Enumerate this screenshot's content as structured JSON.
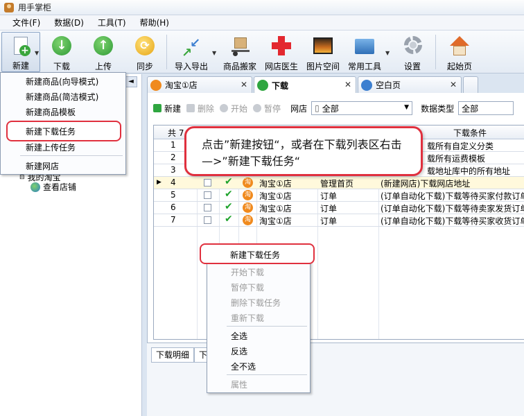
{
  "app": {
    "title": "用手掌柜"
  },
  "menu": [
    "文件(F)",
    "数据(D)",
    "工具(T)",
    "帮助(H)"
  ],
  "toolbar": {
    "new": "新建",
    "download": "下载",
    "upload": "上传",
    "sync": "同步",
    "import_export": "导入导出",
    "move_goods": "商品搬家",
    "shop_doctor": "网店医生",
    "image_space": "图片空间",
    "common_tools": "常用工具",
    "settings": "设置",
    "home": "起始页"
  },
  "new_menu": {
    "items": [
      "新建商品(向导模式)",
      "新建商品(简洁模式)",
      "新建商品模板",
      "新建下载任务",
      "新建上传任务",
      "新建网店"
    ]
  },
  "tree": {
    "my_taobao": "我的淘宝",
    "view_shop": "查看店铺"
  },
  "tabs": [
    {
      "label": "淘宝①店"
    },
    {
      "label": "下载"
    },
    {
      "label": "空白页"
    }
  ],
  "subtoolbar": {
    "new": "新建",
    "delete": "删除",
    "start": "开始",
    "pause": "暂停",
    "shop_label": "网店",
    "shop_value": "全部",
    "datatype_label": "数据类型",
    "datatype_value": "全部"
  },
  "grid": {
    "header_count": "共 7",
    "header_condition": "下载条件",
    "rows": [
      {
        "n": "1",
        "shop": "",
        "type": "",
        "cond": "载所有自定义分类"
      },
      {
        "n": "2",
        "shop": "",
        "type": "",
        "cond": "载所有运费模板"
      },
      {
        "n": "3",
        "shop": "",
        "type": "",
        "cond": "载地址库中的所有地址"
      },
      {
        "n": "4",
        "shop": "淘宝①店",
        "type": "管理首页",
        "cond": "(新建网店)下载网店地址"
      },
      {
        "n": "5",
        "shop": "淘宝①店",
        "type": "订单",
        "cond": "(订单自动化下载)下载等待买家付款订单"
      },
      {
        "n": "6",
        "shop": "淘宝①店",
        "type": "订单",
        "cond": "(订单自动化下载)下载等待卖家发货订单"
      },
      {
        "n": "7",
        "shop": "淘宝①店",
        "type": "订单",
        "cond": "(订单自动化下载)下载等待买家收货订单"
      }
    ]
  },
  "callout": {
    "text": "点击”新建按钮“，或者在下载列表区右击—>”新建下载任务“"
  },
  "context_menu": {
    "items": [
      "新建下载任务",
      "开始下载",
      "暂停下载",
      "删除下载任务",
      "重新下载",
      "全选",
      "反选",
      "全不选",
      "属性"
    ]
  },
  "bottom_tabs": [
    "下载明细",
    "下"
  ],
  "colors": {
    "highlight_red": "#e0303e",
    "accent_green": "#2fa640"
  }
}
